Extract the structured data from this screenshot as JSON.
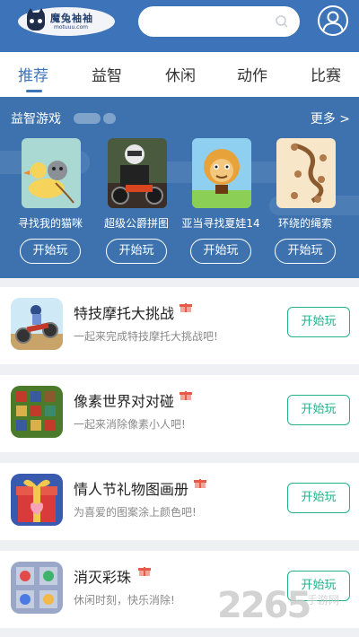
{
  "header": {
    "logo_text": "魔兔袖袖",
    "logo_sub": "motuuu.com",
    "search_placeholder": ""
  },
  "tabs": [
    {
      "label": "推荐",
      "active": true
    },
    {
      "label": "益智",
      "active": false
    },
    {
      "label": "休闲",
      "active": false
    },
    {
      "label": "动作",
      "active": false
    },
    {
      "label": "比赛",
      "active": false
    }
  ],
  "featured": {
    "title": "益智游戏",
    "more_label": "更多 >",
    "games": [
      {
        "name": "寻找我的猫咪",
        "button": "开始玩",
        "icon": "duck-cat-icon"
      },
      {
        "name": "超级公爵拼图",
        "button": "开始玩",
        "icon": "motorbike-rider-icon"
      },
      {
        "name": "亚当寻找夏娃14",
        "button": "开始玩",
        "icon": "caveman-icon"
      },
      {
        "name": "环绕的绳索",
        "button": "开始玩",
        "icon": "rope-puzzle-icon"
      }
    ]
  },
  "list": [
    {
      "title": "特技摩托大挑战",
      "desc": "一起来完成特技摩托大挑战吧!",
      "button": "开始玩",
      "icon": "stunt-bike-icon"
    },
    {
      "title": "像素世界对对碰",
      "desc": "一起来消除像素小人吧!",
      "button": "开始玩",
      "icon": "pixel-people-icon"
    },
    {
      "title": "情人节礼物图画册",
      "desc": "为喜爱的图案涂上颜色吧!",
      "button": "开始玩",
      "icon": "gift-box-icon"
    },
    {
      "title": "消灭彩珠",
      "desc": "休闲时刻，快乐消除!",
      "button": "开始玩",
      "icon": "color-beads-icon"
    }
  ],
  "watermark": {
    "number": "2265",
    "text": "手游网"
  },
  "colors": {
    "header_bg": "#3d73b8",
    "accent_green": "#23b28a",
    "featured_bg": "#3d72ae"
  }
}
